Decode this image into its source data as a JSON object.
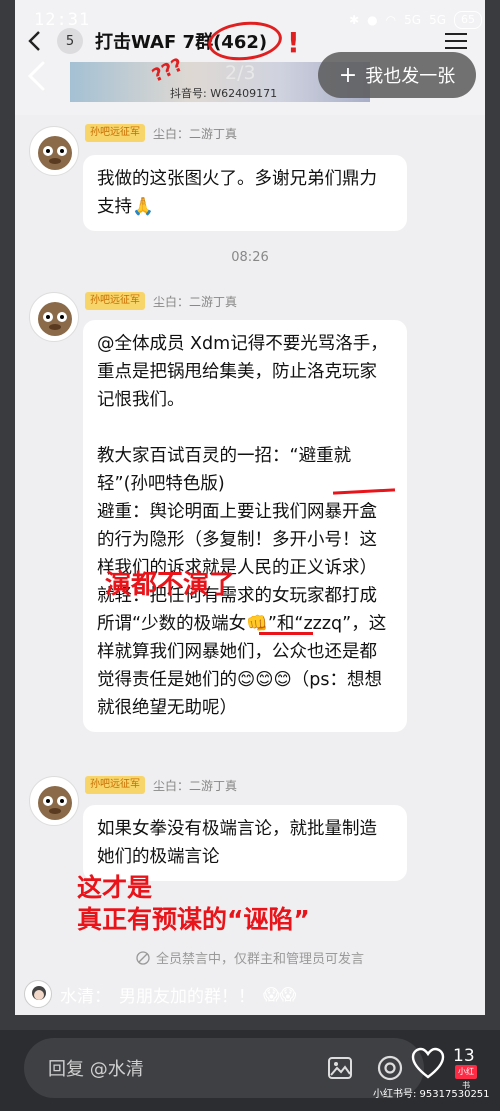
{
  "status": {
    "time": "12:31",
    "battery": "65",
    "net1": "5G",
    "net2": "5G"
  },
  "overlay": {
    "page_counter": "2/3",
    "follow_label": "我也发一张"
  },
  "qq_header": {
    "unread": "5",
    "title": "打击WAF 7群(462)",
    "watermark": "抖音号: W62409171"
  },
  "annotations": {
    "bang": "!",
    "question": "???"
  },
  "messages": [
    {
      "badge": "孙吧远征军",
      "sender": "尘白：二游丁真",
      "text": "我做的这张图火了。多谢兄弟们鼎力支持🙏"
    },
    {
      "badge": "孙吧远征军",
      "sender": "尘白：二游丁真",
      "text": "@全体成员 Xdm记得不要光骂洛手，重点是把锅甩给集美，防止洛克玩家记恨我们。\n\n教大家百试百灵的一招：“避重就轻”(孙吧特色版)\n避重：舆论明面上要让我们网暴开盒的行为隐形（多复制！多开小号！这样我们的诉求就是人民的正义诉求）\n就轻：把任何有需求的女玩家都打成所谓“少数的极端女👊”和“zzzq”，这样就算我们网暴她们，公众也还是都觉得责任是她们的😊😊😊（ps：想想就很绝望无助呢）"
    },
    {
      "badge": "孙吧远征军",
      "sender": "尘白：二游丁真",
      "text": "如果女拳没有极端言论，就批量制造她们的极端言论"
    }
  ],
  "timestamp": "08:26",
  "red_text": {
    "middle": "演都不演了",
    "bottom_line1": "这才是",
    "bottom_line2": "真正有预谋的“诬陷”"
  },
  "mute_notice": "全员禁言中，仅群主和管理员可发言",
  "danmaku": {
    "name": "水清：",
    "text": "男朋友加的群！！",
    "emoji": "😱😱"
  },
  "bottom": {
    "reply_placeholder": "回复 @水清",
    "like_count": "13",
    "xhs_logo": "小红书",
    "xhs_id": "小红书号: 95317530251"
  }
}
